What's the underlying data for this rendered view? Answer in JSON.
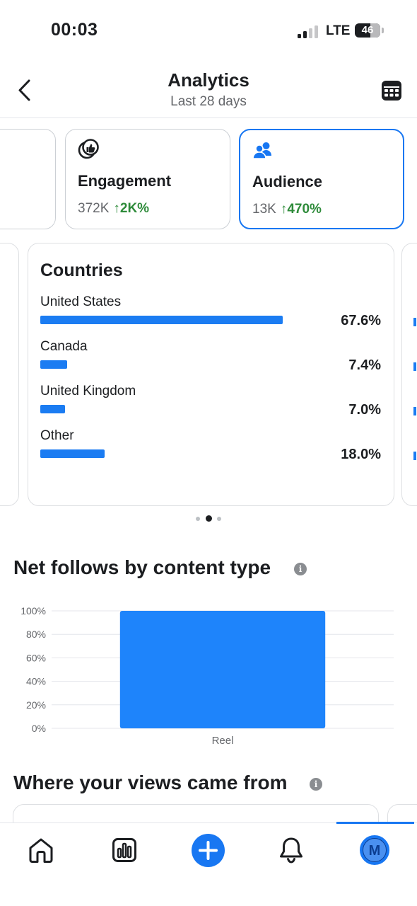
{
  "status_bar": {
    "time": "00:03",
    "network": "LTE",
    "battery": "46"
  },
  "header": {
    "title": "Analytics",
    "subtitle": "Last 28 days",
    "back_icon": "chevron-left-icon",
    "calendar_icon": "calendar-icon"
  },
  "metric_cards": [
    {
      "label": "Engagement",
      "value": "372K",
      "delta": "↑2K%",
      "icon": "thumbs-up-icon",
      "selected": false
    },
    {
      "label": "Audience",
      "value": "13K",
      "delta": "↑470%",
      "icon": "people-icon",
      "selected": true
    }
  ],
  "countries": {
    "title": "Countries",
    "rows": [
      {
        "name": "United States",
        "pct": "67.6%",
        "value": 67.6
      },
      {
        "name": "Canada",
        "pct": "7.4%",
        "value": 7.4
      },
      {
        "name": "United Kingdom",
        "pct": "7.0%",
        "value": 7.0
      },
      {
        "name": "Other",
        "pct": "18.0%",
        "value": 18.0
      }
    ]
  },
  "carousel": {
    "page_count": 3,
    "active_page": 1
  },
  "net_follows": {
    "title": "Net follows by content type"
  },
  "chart_data": {
    "type": "bar",
    "categories": [
      "Reel"
    ],
    "values": [
      100
    ],
    "ylim": [
      0,
      100
    ],
    "yticks": [
      "0%",
      "20%",
      "40%",
      "60%",
      "80%",
      "100%"
    ],
    "grid": true,
    "color": "#1e84fb"
  },
  "views_section": {
    "title": "Where your views came from"
  },
  "bottom_nav": {
    "items": [
      "home-icon",
      "insights-icon",
      "create-plus-icon",
      "notifications-bell-icon",
      "profile-avatar"
    ],
    "avatar_initial": "M",
    "active": "profile-avatar"
  },
  "colors": {
    "accent": "#1877f2",
    "positive": "#2e8b3a",
    "bar": "#1b7cf2"
  }
}
